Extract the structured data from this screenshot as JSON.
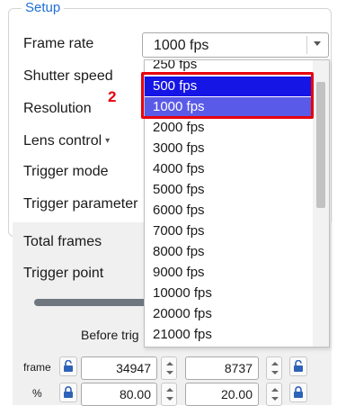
{
  "group_title": "Setup",
  "labels": {
    "frame_rate": "Frame rate",
    "shutter_speed": "Shutter speed",
    "resolution": "Resolution",
    "lens_control": "Lens control",
    "trigger_mode": "Trigger mode",
    "trigger_parameter": "Trigger parameter",
    "total_frames": "Total frames",
    "trigger_point": "Trigger point"
  },
  "frame_rate_combo": {
    "value": "1000 fps"
  },
  "dropdown": {
    "options": [
      "250 fps",
      "500 fps",
      "1000 fps",
      "2000 fps",
      "3000 fps",
      "4000 fps",
      "5000 fps",
      "6000 fps",
      "7000 fps",
      "8000 fps",
      "9000 fps",
      "10000 fps",
      "20000 fps",
      "21000 fps"
    ],
    "highlighted": "500 fps",
    "selected": "1000 fps"
  },
  "callout_number": "2",
  "frames_table": {
    "before_trigger_label": "Before trig",
    "rows": [
      {
        "unit": "frame",
        "before": "34947",
        "after": "8737"
      },
      {
        "unit": "%",
        "before": "80.00",
        "after": "20.00"
      }
    ]
  },
  "colors": {
    "accent_title": "#1f6fd6",
    "highlight_blue": "#1515e6",
    "selected_blue": "#5a5ae8",
    "callout_red": "#e8000d"
  }
}
